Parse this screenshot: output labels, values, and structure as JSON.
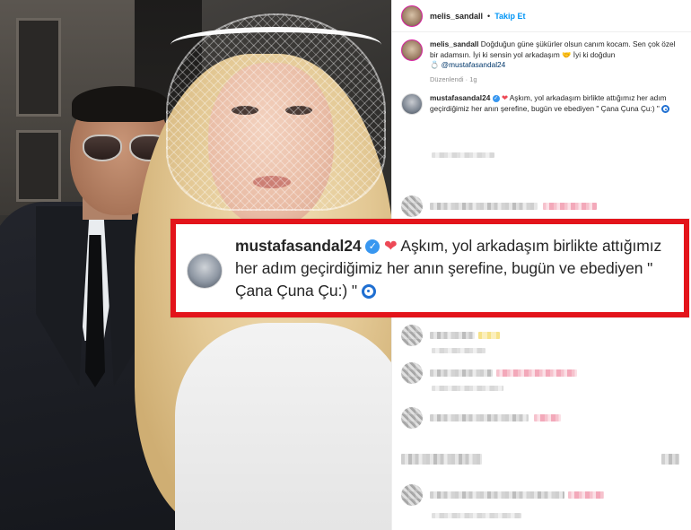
{
  "post": {
    "author": "melis_sandall",
    "separator": "•",
    "follow_label": "Takip Et",
    "caption_text": "Doğduğun güne şükürler olsun canım kocam. Sen çok özel bir adamsın. İyi ki sensin yol arkadaşım",
    "caption_text_2": "İyi ki doğdun",
    "caption_mention": "@mustafasandal24",
    "caption_meta": "Düzenlendi · 1g"
  },
  "reply": {
    "author": "mustafasandal24",
    "text": "Aşkım, yol arkadaşım birlikte attığımız her adım geçirdiğimiz her anın şerefine, bugün ve ebediyen \" Çana Çuna Çu:) \""
  },
  "callout": {
    "author": "mustafasandal24",
    "text": "Aşkım, yol arkadaşım birlikte attığımız her adım geçirdiğimiz her anın şerefine, bugün ve ebediyen \" Çana Çuna Çu:) \""
  },
  "icons": {
    "verified": "✓",
    "heart": "❤"
  },
  "colors": {
    "callout_border": "#e3141b",
    "follow_blue": "#0095f6",
    "verified_blue": "#3897f0",
    "heart_red": "#ed4956"
  }
}
